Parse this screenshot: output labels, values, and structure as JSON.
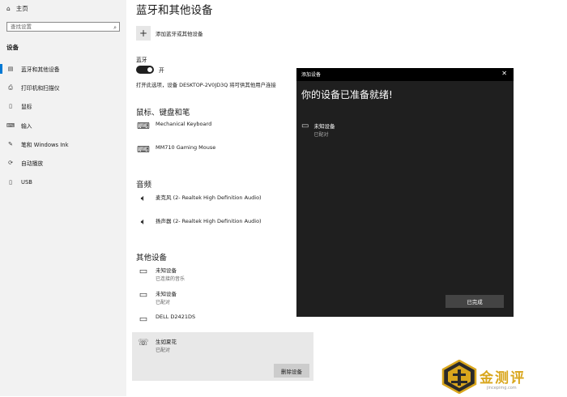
{
  "sidebar": {
    "home_label": "主页",
    "search_placeholder": "查找设置",
    "section_label": "设备",
    "items": [
      {
        "label": "蓝牙和其他设备",
        "icon": "bluetooth-devices-icon",
        "active": true
      },
      {
        "label": "打印机和扫描仪",
        "icon": "printer-icon",
        "active": false
      },
      {
        "label": "鼠标",
        "icon": "mouse-icon",
        "active": false
      },
      {
        "label": "输入",
        "icon": "keyboard-icon",
        "active": false
      },
      {
        "label": "笔和 Windows Ink",
        "icon": "pen-icon",
        "active": false
      },
      {
        "label": "自动播放",
        "icon": "autoplay-icon",
        "active": false
      },
      {
        "label": "USB",
        "icon": "usb-icon",
        "active": false
      }
    ]
  },
  "main": {
    "title": "蓝牙和其他设备",
    "add_device_label": "添加蓝牙或其他设备",
    "bluetooth_label": "蓝牙",
    "toggle_state": "开",
    "bluetooth_desc": "打开此选项，设备 DESKTOP-2V0JD3Q 将可供其他用户连接",
    "sections": {
      "mouse_keyboard": {
        "heading": "鼠标、键盘和笔",
        "devices": [
          {
            "name": "Mechanical Keyboard",
            "status": ""
          },
          {
            "name": "MM710 Gaming Mouse",
            "status": ""
          }
        ]
      },
      "audio": {
        "heading": "音频",
        "devices": [
          {
            "name": "麦克风 (2- Realtek High Definition Audio)",
            "status": ""
          },
          {
            "name": "扬声器 (2- Realtek High Definition Audio)",
            "status": ""
          }
        ]
      },
      "other": {
        "heading": "其他设备",
        "devices": [
          {
            "name": "未知设备",
            "status": "已连接的音乐"
          },
          {
            "name": "未知设备",
            "status": "已配对"
          },
          {
            "name": "DELL D2421DS",
            "status": ""
          },
          {
            "name": "生如夏花",
            "status": "已配对"
          }
        ]
      }
    },
    "remove_button": "删除设备"
  },
  "dialog": {
    "title": "添加设备",
    "heading": "你的设备已准备就绪!",
    "device_name": "未知设备",
    "device_status": "已配对",
    "done_button": "已完成",
    "close_glyph": "✕"
  },
  "watermark": {
    "text": "金测评",
    "url": "jincepimg.com",
    "color": "#d9a61c"
  },
  "colors": {
    "accent": "#0078d4",
    "dialog_bg": "#1f1f1f"
  }
}
